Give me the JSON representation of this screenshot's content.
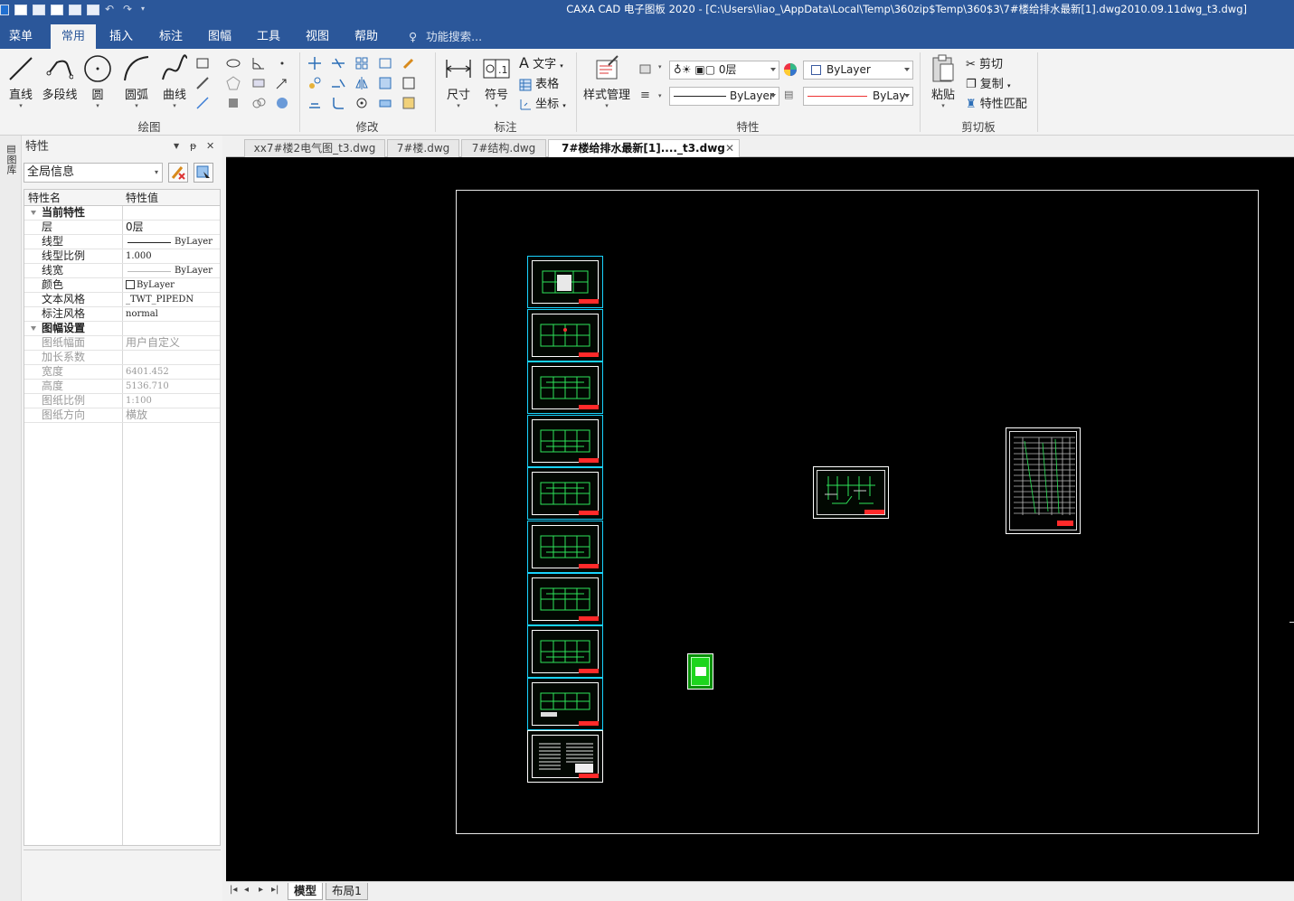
{
  "app": {
    "window_title": "CAXA CAD 电子图板 2020 - [C:\\Users\\liao_\\AppData\\Local\\Temp\\360zip$Temp\\360$3\\7#楼给排水最新[1].dwg2010.09.11dwg_t3.dwg]",
    "accent": "#2b579a"
  },
  "menubar": {
    "items": [
      {
        "label": "菜单"
      },
      {
        "label": "常用",
        "active": true
      },
      {
        "label": "插入"
      },
      {
        "label": "标注"
      },
      {
        "label": "图幅"
      },
      {
        "label": "工具"
      },
      {
        "label": "视图"
      },
      {
        "label": "帮助"
      }
    ],
    "search_label": "功能搜索..."
  },
  "ribbon": {
    "draw": {
      "label": "绘图",
      "line": "直线",
      "polyline": "多段线",
      "circle": "圆",
      "arc": "圆弧",
      "curve": "曲线"
    },
    "modify": {
      "label": "修改"
    },
    "annotate": {
      "label": "标注",
      "dimension": "尺寸",
      "symbol": "符号",
      "text": "文字",
      "table": "表格",
      "coord": "坐标"
    },
    "style_manager": "样式管理",
    "properties": {
      "label": "特性",
      "layer": "0层",
      "color": "ByLayer",
      "linetype": "ByLayer",
      "lineweight": "ByLay"
    },
    "clipboard": {
      "label": "剪切板",
      "paste": "粘贴",
      "cut": "剪切",
      "copy": "复制",
      "match": "特性匹配"
    }
  },
  "left_strip": {
    "label": "图库"
  },
  "props_panel": {
    "title": "特性",
    "pin": "ᵽ",
    "close": "✕",
    "scope": "全局信息",
    "col_name": "特性名",
    "col_value": "特性值",
    "group_current": "当前特性",
    "group_frame": "图幅设置",
    "rows_current": [
      {
        "name": "层",
        "value": "0层"
      },
      {
        "name": "线型",
        "value": "ByLayer"
      },
      {
        "name": "线型比例",
        "value": "1.000"
      },
      {
        "name": "线宽",
        "value": "ByLayer"
      },
      {
        "name": "颜色",
        "value": "ByLayer"
      },
      {
        "name": "文本风格",
        "value": "_TWT_PIPEDN"
      },
      {
        "name": "标注风格",
        "value": "normal"
      }
    ],
    "rows_frame": [
      {
        "name": "图纸幅面",
        "value": "用户自定义"
      },
      {
        "name": "加长系数",
        "value": ""
      },
      {
        "name": "宽度",
        "value": "6401.452"
      },
      {
        "name": "高度",
        "value": "5136.710"
      },
      {
        "name": "图纸比例",
        "value": "1:100"
      },
      {
        "name": "图纸方向",
        "value": "横放"
      }
    ]
  },
  "doc_tabs": [
    {
      "label": "xx7#楼2电气图_t3.dwg"
    },
    {
      "label": "7#楼.dwg"
    },
    {
      "label": "7#结构.dwg"
    },
    {
      "label": "7#楼给排水最新[1]...._t3.dwg",
      "active": true,
      "close": "✕"
    }
  ],
  "layout_tabs": [
    {
      "label": "模型",
      "active": true
    },
    {
      "label": "布局1"
    }
  ]
}
